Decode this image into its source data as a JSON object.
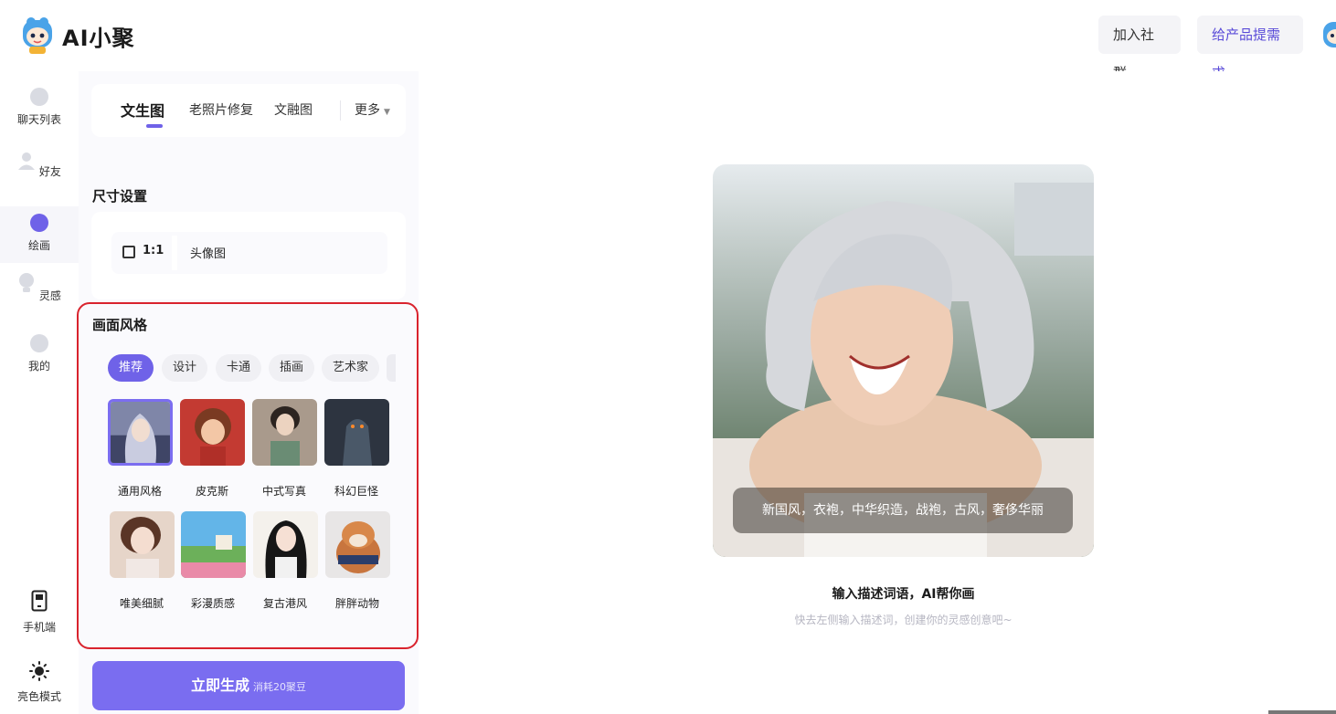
{
  "app": {
    "name": "AI小聚"
  },
  "header": {
    "join_label": "加入社群",
    "request_label": "给产品提需求"
  },
  "nav": {
    "items": [
      {
        "label": "聊天列表",
        "icon": "chat-icon"
      },
      {
        "label": "好友",
        "icon": "user-icon"
      },
      {
        "label": "绘画",
        "icon": "palette-icon"
      },
      {
        "label": "灵感",
        "icon": "bulb-icon"
      },
      {
        "label": "我的",
        "icon": "profile-icon"
      }
    ],
    "phone_label": "手机端",
    "light_label": "亮色模式"
  },
  "tabs": {
    "items": [
      "文生图",
      "老照片修复",
      "文融图"
    ],
    "more_label": "更多",
    "active": "文生图"
  },
  "size": {
    "title": "尺寸设置",
    "ratio": "1:1",
    "name": "头像图"
  },
  "style": {
    "title": "画面风格",
    "chips": [
      "推荐",
      "设计",
      "卡通",
      "插画",
      "艺术家"
    ],
    "active_chip": "推荐",
    "cards": [
      {
        "label": "通用风格",
        "selected": true
      },
      {
        "label": "皮克斯"
      },
      {
        "label": "中式写真"
      },
      {
        "label": "科幻巨怪"
      },
      {
        "label": "唯美细腻"
      },
      {
        "label": "彩漫质感"
      },
      {
        "label": "复古港风"
      },
      {
        "label": "胖胖动物"
      }
    ]
  },
  "generate": {
    "label": "立即生成",
    "cost": "消耗20聚豆"
  },
  "preview": {
    "caption": "新国风，衣袍，中华织造，战袍，古风，奢侈华丽",
    "hint_title": "输入描述词语，AI帮你画",
    "hint_sub": "快去左侧输入描述词，创建你的灵感创意吧~"
  },
  "colors": {
    "accent": "#6f62e8",
    "highlight_border": "#d9232d"
  }
}
